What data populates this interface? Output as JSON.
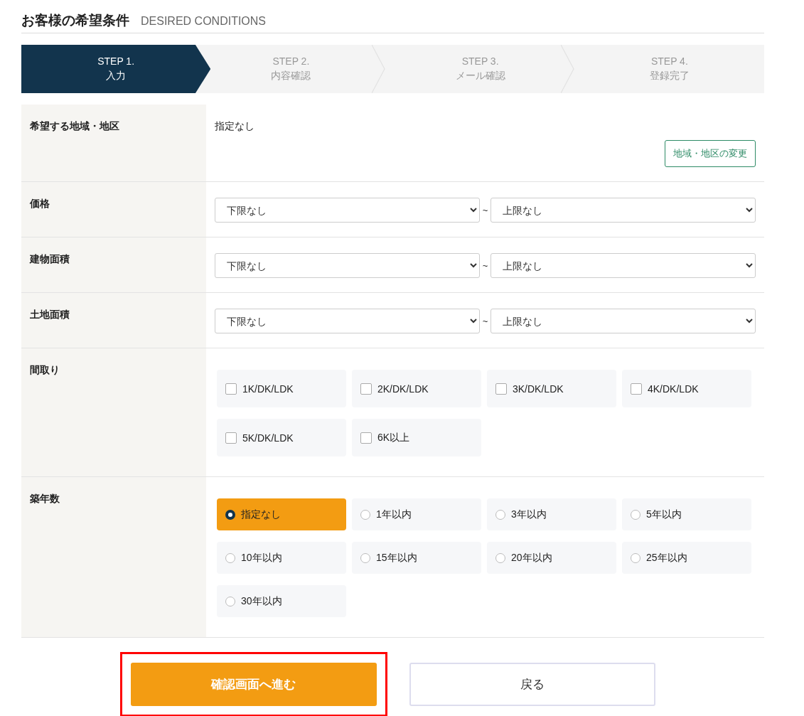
{
  "header": {
    "title": "お客様の希望条件",
    "subtitle": "DESIRED CONDITIONS"
  },
  "steps": [
    {
      "label": "STEP 1.",
      "name": "入力",
      "selected": true
    },
    {
      "label": "STEP 2.",
      "name": "内容確認",
      "selected": false
    },
    {
      "label": "STEP 3.",
      "name": "メール確認",
      "selected": false
    },
    {
      "label": "STEP 4.",
      "name": "登録完了",
      "selected": false
    }
  ],
  "form": [
    {
      "kind": "region",
      "label": "希望する地域・地区",
      "value": "指定なし",
      "button": "地域・地区の変更"
    },
    {
      "kind": "range",
      "label": "価格",
      "min": "下限なし",
      "separator": "~",
      "max": "上限なし"
    },
    {
      "kind": "range",
      "label": "建物面積",
      "min": "下限なし",
      "separator": "~",
      "max": "上限なし"
    },
    {
      "kind": "range",
      "label": "土地面積",
      "min": "下限なし",
      "separator": "~",
      "max": "上限なし"
    },
    {
      "kind": "checkboxes",
      "label": "間取り",
      "options": [
        {
          "label": "1K/DK/LDK",
          "checked": false
        },
        {
          "label": "2K/DK/LDK",
          "checked": false
        },
        {
          "label": "3K/DK/LDK",
          "checked": false
        },
        {
          "label": "4K/DK/LDK",
          "checked": false
        },
        {
          "label": "5K/DK/LDK",
          "checked": false
        },
        {
          "label": "6K以上",
          "checked": false
        }
      ]
    },
    {
      "kind": "radios",
      "label": "築年数",
      "options": [
        {
          "label": "指定なし",
          "selected": true
        },
        {
          "label": "1年以内",
          "selected": false
        },
        {
          "label": "3年以内",
          "selected": false
        },
        {
          "label": "5年以内",
          "selected": false
        },
        {
          "label": "10年以内",
          "selected": false
        },
        {
          "label": "15年以内",
          "selected": false
        },
        {
          "label": "20年以内",
          "selected": false
        },
        {
          "label": "25年以内",
          "selected": false
        },
        {
          "label": "30年以内",
          "selected": false
        }
      ]
    }
  ],
  "actions": [
    {
      "kind": "primary",
      "label": "確認画面へ進む",
      "highlighted": true
    },
    {
      "kind": "secondary",
      "label": "戻る",
      "highlighted": false
    }
  ]
}
